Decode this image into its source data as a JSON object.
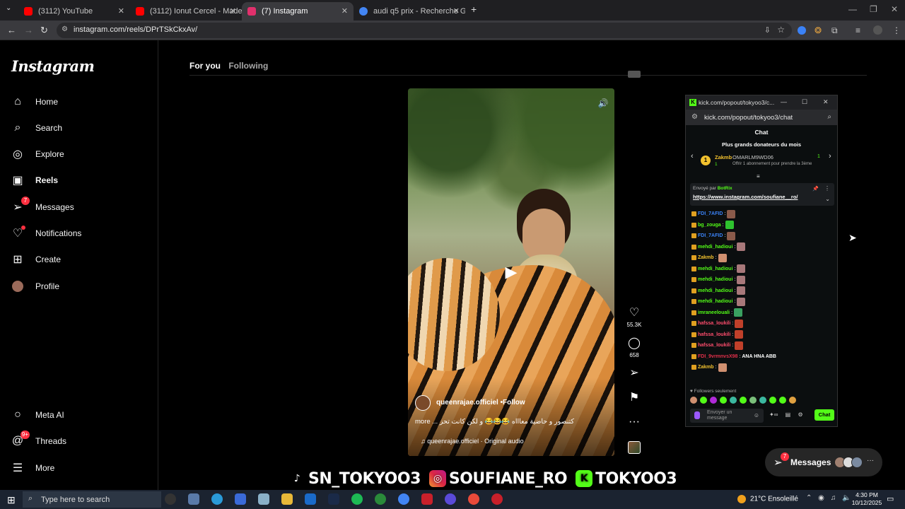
{
  "browser": {
    "tabs": [
      {
        "title": "(3112) YouTube",
        "color": "#ff0000",
        "active": false
      },
      {
        "title": "(3112) Ionut Cercel - Made in R",
        "color": "#ff0000",
        "active": false
      },
      {
        "title": "(7) Instagram",
        "color": "#e1306c",
        "active": true
      },
      {
        "title": "audi q5 prix - Recherche Googl",
        "color": "#4285f4",
        "active": false
      }
    ],
    "new_tab": "+",
    "url": "instagram.com/reels/DPrTSkCkxAv/"
  },
  "sidebar": {
    "logo": "Instagram",
    "items": [
      {
        "label": "Home",
        "icon": "home-icon",
        "glyph": "⌂"
      },
      {
        "label": "Search",
        "icon": "search-icon",
        "glyph": "⌕"
      },
      {
        "label": "Explore",
        "icon": "explore-icon",
        "glyph": "◎"
      },
      {
        "label": "Reels",
        "icon": "reels-icon",
        "glyph": "▣"
      },
      {
        "label": "Messages",
        "icon": "messages-icon",
        "glyph": "➢",
        "badge": "7"
      },
      {
        "label": "Notifications",
        "icon": "heart-icon",
        "glyph": "♡"
      },
      {
        "label": "Create",
        "icon": "plus-icon",
        "glyph": "⊞"
      },
      {
        "label": "Profile",
        "icon": "avatar-icon",
        "glyph": "●"
      }
    ],
    "bottom": [
      {
        "label": "Meta AI",
        "icon": "meta-ai-icon",
        "glyph": "○"
      },
      {
        "label": "Threads",
        "icon": "threads-icon",
        "glyph": "@",
        "badge": "9+"
      },
      {
        "label": "More",
        "icon": "menu-icon",
        "glyph": "☰"
      }
    ]
  },
  "feed": {
    "tabs": [
      "For you",
      "Following"
    ],
    "reel": {
      "username": "queenrajae.officiel",
      "follow": "Follow",
      "caption": "more ... كتنصور و حاضية معاااه 😂😂😂 و لكن كانت تحز",
      "audio": "queenrajae.officiel · Original audio",
      "likes": "55.3K",
      "comments": "658"
    }
  },
  "kick": {
    "window_title": "kick.com/popout/tokyoo3/c...",
    "url": "kick.com/popout/tokyoo3/chat",
    "chat_label": "Chat",
    "donors_title": "Plus grands donateurs du mois",
    "donor": {
      "rank": "1",
      "name": "Zakmb",
      "count": "1",
      "next_name": "OMARLM9WD06",
      "next_count": "1",
      "next_sub": "Offrir 1 abonnement pour prendre la 3ème"
    },
    "pinned": {
      "sent_by": "Envoyé par",
      "bot": "BotRix",
      "link": "https://www.instagram.com/soufiane__ro/"
    },
    "messages": [
      {
        "user": "FDI_7AFID",
        "color": "#3b82f6",
        "emote": "#8a5a4a",
        "text": ""
      },
      {
        "user": "bg_zouga",
        "color": "#53fc18",
        "emote": "#2ec22e",
        "text": ""
      },
      {
        "user": "FDI_7AFID",
        "color": "#3b82f6",
        "emote": "#8a5a4a",
        "text": ""
      },
      {
        "user": "mehdi_hadioui",
        "color": "#53fc18",
        "emote": "#a8787a",
        "text": ""
      },
      {
        "user": "Zakmb",
        "color": "#f2c12e",
        "emote": "#d09070",
        "text": ""
      },
      {
        "user": "mehdi_hadioui",
        "color": "#53fc18",
        "emote": "#a8787a",
        "text": ""
      },
      {
        "user": "mehdi_hadioui",
        "color": "#53fc18",
        "emote": "#a8787a",
        "text": ""
      },
      {
        "user": "mehdi_hadioui",
        "color": "#53fc18",
        "emote": "#a8787a",
        "text": ""
      },
      {
        "user": "mehdi_hadioui",
        "color": "#53fc18",
        "emote": "#a8787a",
        "text": ""
      },
      {
        "user": "imraneelouali",
        "color": "#53fc18",
        "emote": "#3aa060",
        "text": ""
      },
      {
        "user": "hafssa_loukili",
        "color": "#ff4d6d",
        "emote": "#c0402a",
        "text": ""
      },
      {
        "user": "hafssa_loukili",
        "color": "#ff4d6d",
        "emote": "#c0402a",
        "text": ""
      },
      {
        "user": "hafssa_loukili",
        "color": "#ff4d6d",
        "emote": "#c0402a",
        "text": ""
      },
      {
        "user": "FDI_9vrmnvsX98",
        "color": "#e0304a",
        "emote": "",
        "text": "ANA HNA ABB"
      },
      {
        "user": "Zakmb",
        "color": "#f2c12e",
        "emote": "#d09070",
        "text": ""
      }
    ],
    "followers_only": "Followers seulement",
    "input_placeholder": "Envoyer un message",
    "send_label": "Chat"
  },
  "watermark": {
    "tiktok": "SN_TOKYOO3",
    "instagram": "SOUFIANE_RO",
    "kick": "TOKYOO3"
  },
  "messages_pill": {
    "label": "Messages",
    "badge": "7"
  },
  "taskbar": {
    "search_placeholder": "Type here to search",
    "weather": "21°C  Ensoleillé",
    "time": "4:30 PM",
    "date": "10/12/2025"
  }
}
